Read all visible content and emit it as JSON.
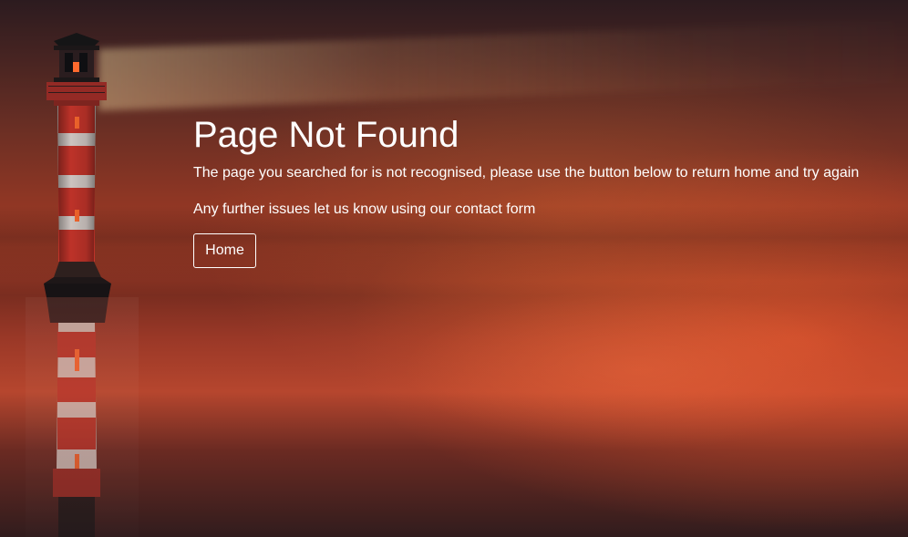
{
  "page": {
    "title": "Page Not Found",
    "message_primary": "The page you searched for is not recognised, please use the button below to return home and try again",
    "message_secondary": "Any further issues let us know using our contact form",
    "home_button_label": "Home"
  },
  "colors": {
    "text": "#FFFFFF",
    "sky_dark": "#2C1B1F",
    "sunset_orange": "#B6462E",
    "lighthouse_red": "#C7352B",
    "lighthouse_white": "#D8D2CF"
  },
  "icons": {
    "lighthouse": "lighthouse-icon"
  }
}
